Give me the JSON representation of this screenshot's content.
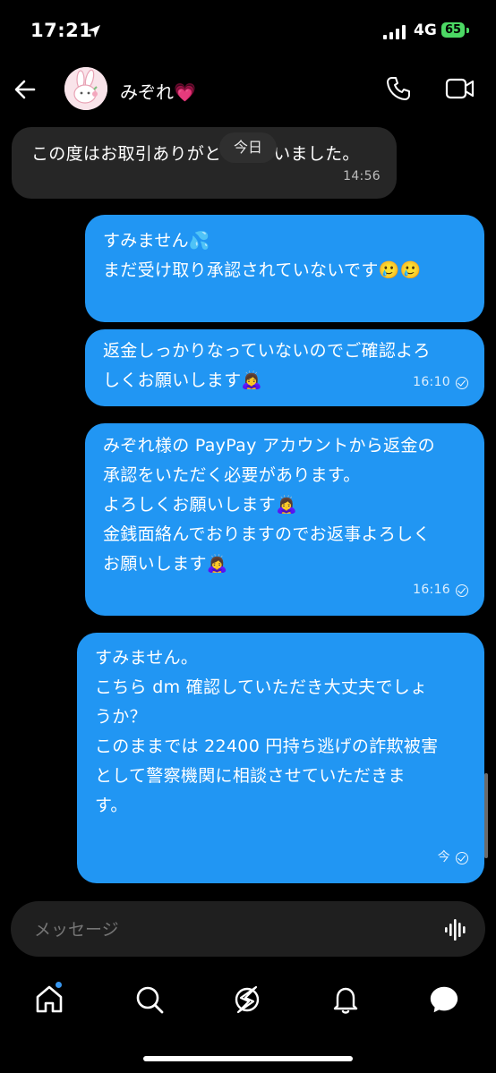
{
  "status_bar": {
    "time": "17:21",
    "network": "4G",
    "battery": "65"
  },
  "header": {
    "contact_name": "みぞれ💗"
  },
  "date_chip": "今日",
  "messages": [
    {
      "direction": "in",
      "lines": [
        "この度はお取引ありがとうございました。"
      ],
      "time": "14:56"
    },
    {
      "direction": "out",
      "lines": [
        "すみません💦",
        "",
        "まだ受け取り承認されていないです🥲🥲"
      ],
      "time": ""
    },
    {
      "direction": "out",
      "lines": [
        "返金しっかりなっていないのでご確認よろ",
        "しくお願いします🙇‍♀️"
      ],
      "time": "16:10"
    },
    {
      "direction": "out",
      "lines": [
        "みぞれ様の PayPay アカウントから返金の",
        "承認をいただく必要があります。",
        "",
        "よろしくお願いします🙇‍♀️",
        "金銭面絡んでおりますのでお返事よろしく",
        "お願いします🙇‍♀️"
      ],
      "time": "16:16"
    },
    {
      "direction": "out",
      "lines": [
        "すみません。",
        "",
        "こちら dm 確認していただき大丈夫でしょ",
        "うか？",
        "",
        "このままでは 22400 円持ち逃げの詐欺被害",
        "として警察機関に相談させていただきま",
        "す。"
      ],
      "time": "今"
    }
  ],
  "composer": {
    "placeholder": "メッセージ"
  },
  "icons": {
    "back": "back-arrow-icon",
    "phone": "phone-icon",
    "video": "video-camera-icon",
    "mic": "voice-waveform-icon",
    "home": "home-icon",
    "search": "search-icon",
    "explore": "explore-icon",
    "notifications": "bell-icon",
    "messages": "messages-icon"
  },
  "colors": {
    "outgoing_bubble": "#2196f3",
    "incoming_bubble": "#262626",
    "background": "#000000",
    "battery": "#4cd964"
  }
}
